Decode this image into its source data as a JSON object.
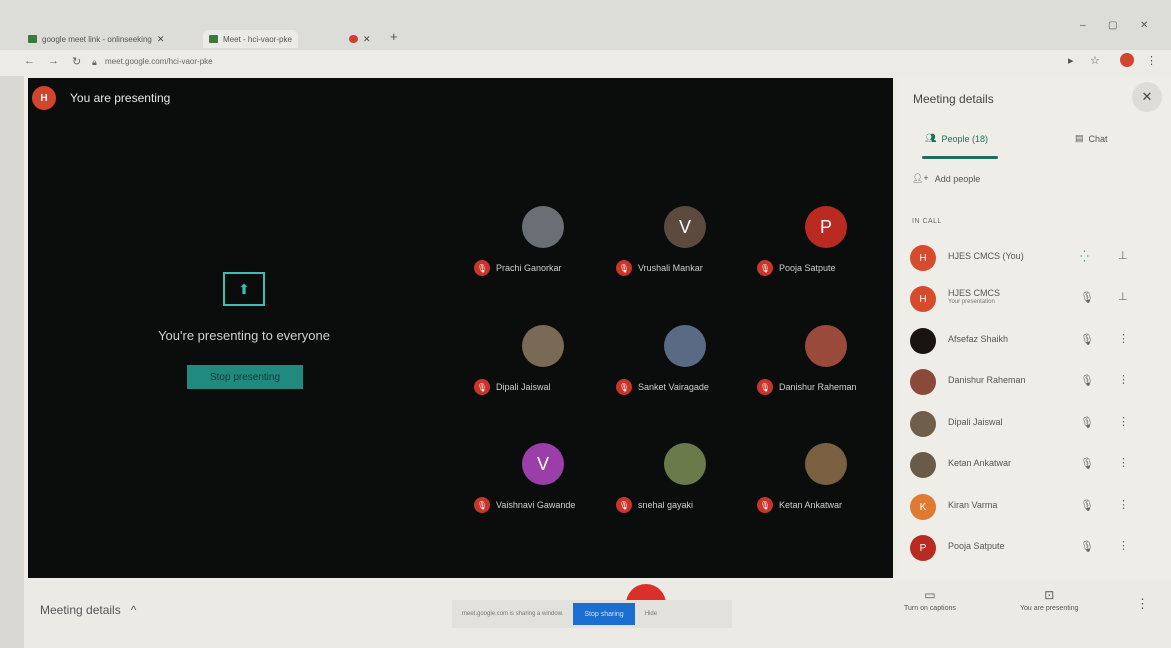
{
  "browser": {
    "tabs": [
      {
        "label": "google meet link - onlinseeking"
      },
      {
        "label": "Meet - hci-vaor-pke"
      },
      {
        "label": ""
      }
    ],
    "url": "meet.google.com/hci-vaor-pke"
  },
  "stage": {
    "presenter_initial": "H",
    "presenter_label": "You are presenting",
    "present_text": "You're presenting to everyone",
    "stop_presenting": "Stop presenting"
  },
  "participants": [
    {
      "name": "Prachi Ganorkar",
      "initial": "",
      "color": "#6a6f75"
    },
    {
      "name": "Vrushali Mankar",
      "initial": "V",
      "color": "#5d4a3e"
    },
    {
      "name": "Pooja Satpute",
      "initial": "P",
      "color": "#b82a22"
    },
    {
      "name": "Dipali Jaiswal",
      "initial": "",
      "color": "#7a6a55"
    },
    {
      "name": "Sanket Vairagade",
      "initial": "",
      "color": "#5a6a85"
    },
    {
      "name": "Danishur Raheman",
      "initial": "",
      "color": "#9a4a3a"
    },
    {
      "name": "Vaishnavi Gawande",
      "initial": "V",
      "color": "#9b3fa8"
    },
    {
      "name": "snehal gayaki",
      "initial": "",
      "color": "#6b7a4a"
    },
    {
      "name": "Ketan Ankatwar",
      "initial": "",
      "color": "#7a6040"
    }
  ],
  "panel": {
    "title": "Meeting details",
    "people_tab": "People (18)",
    "chat_tab": "Chat",
    "add_people": "Add people",
    "in_call": "IN CALL",
    "people": [
      {
        "name": "HJES CMCS (You)",
        "sub": "",
        "initial": "H",
        "color": "#d54b2c",
        "mic": "on"
      },
      {
        "name": "HJES CMCS",
        "sub": "Your presentation",
        "initial": "H",
        "color": "#d54b2c",
        "mic": "off"
      },
      {
        "name": "Afsefaz Shaikh",
        "sub": "",
        "initial": "",
        "color": "#1a1410",
        "mic": "off"
      },
      {
        "name": "Danishur Raheman",
        "sub": "",
        "initial": "",
        "color": "#8a4a3a",
        "mic": "off"
      },
      {
        "name": "Dipali Jaiswal",
        "sub": "",
        "initial": "",
        "color": "#6e5e4a",
        "mic": "off"
      },
      {
        "name": "Ketan Ankatwar",
        "sub": "",
        "initial": "",
        "color": "#6a5a48",
        "mic": "off"
      },
      {
        "name": "Kiran Varma",
        "sub": "",
        "initial": "K",
        "color": "#e07a32",
        "mic": "off"
      },
      {
        "name": "Pooja Satpute",
        "sub": "",
        "initial": "P",
        "color": "#b82a22",
        "mic": "off"
      }
    ]
  },
  "bottom": {
    "meeting_details": "Meeting details",
    "share_notice": "meet.google.com is sharing a window.",
    "stop_sharing": "Stop sharing",
    "hide": "Hide",
    "captions": "Turn on captions",
    "presenting": "You are presenting"
  },
  "colors": {
    "accent": "#1e6f5c",
    "stop_presenting_bg": "#1f8a7d",
    "stop_sharing_bg": "#1a6fd0",
    "end_call": "#d9302a"
  }
}
